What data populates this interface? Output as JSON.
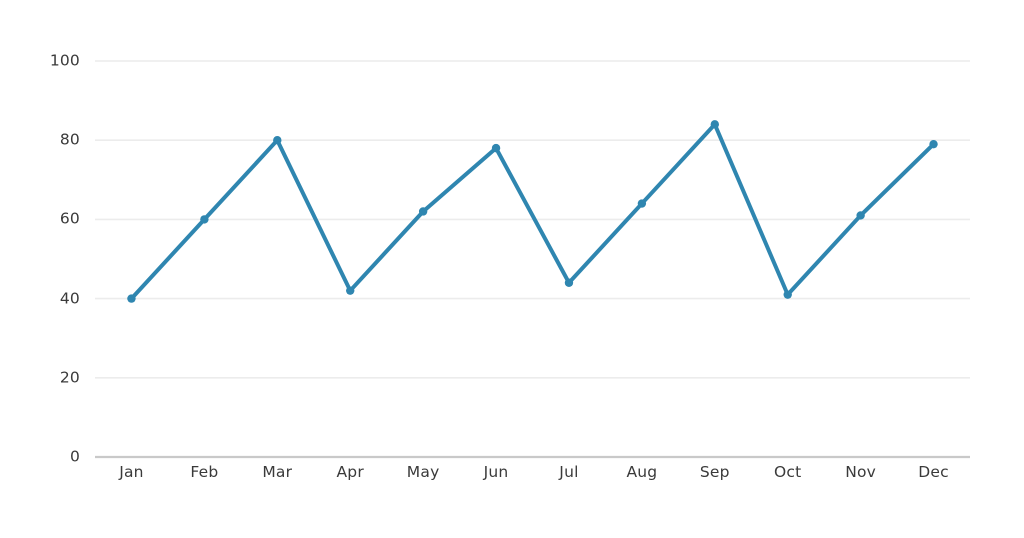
{
  "chart_data": {
    "type": "line",
    "title": "",
    "subtitle": "",
    "xlabel": "",
    "ylabel": "",
    "categories": [
      "Jan",
      "Feb",
      "Mar",
      "Apr",
      "May",
      "Jun",
      "Jul",
      "Aug",
      "Sep",
      "Oct",
      "Nov",
      "Dec"
    ],
    "values": [
      40,
      60,
      80,
      42,
      62,
      78,
      44,
      64,
      84,
      41,
      61,
      79
    ],
    "series": [
      {
        "name": "",
        "values": [
          40,
          60,
          80,
          42,
          62,
          78,
          44,
          64,
          84,
          41,
          61,
          79
        ]
      }
    ],
    "ylim": [
      0,
      100
    ],
    "y_ticks": [
      0,
      20,
      40,
      60,
      80,
      100
    ],
    "y_tick_labels": [
      "0",
      "20",
      "40",
      "60",
      "80",
      "100"
    ],
    "x_tick_labels": [
      "Jan",
      "Feb",
      "Mar",
      "Apr",
      "May",
      "Jun",
      "Jul",
      "Aug",
      "Sep",
      "Oct",
      "Nov",
      "Dec"
    ],
    "grid": {
      "horizontal": true,
      "vertical": false
    },
    "legend": {
      "visible": false,
      "position": "none",
      "entries": []
    },
    "annotations": [],
    "markers": {
      "visible": true,
      "shape": "circle"
    }
  },
  "style": {
    "background_color": "#ffffff",
    "line_color": "#2f86b0",
    "marker_color": "#2f86b0",
    "gridline_color": "#ececec",
    "axis_line_color": "#c9c9c9",
    "tick_label_color": "#3a3a3a",
    "line_width": 4,
    "marker_radius": 4.2
  }
}
